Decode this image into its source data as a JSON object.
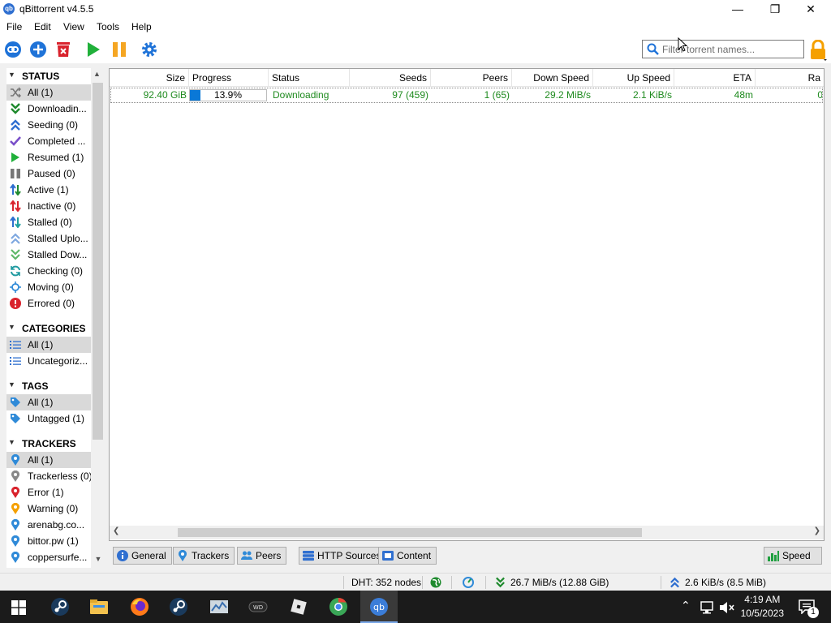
{
  "window": {
    "title": "qBittorrent v4.5.5",
    "app_icon_text": "qb"
  },
  "menu": [
    "File",
    "Edit",
    "View",
    "Tools",
    "Help"
  ],
  "search": {
    "placeholder": "Filter torrent names..."
  },
  "sidebar": {
    "status_header": "STATUS",
    "status": [
      "All (1)",
      "Downloadin...",
      "Seeding (0)",
      "Completed ...",
      "Resumed (1)",
      "Paused (0)",
      "Active (1)",
      "Inactive (0)",
      "Stalled (0)",
      "Stalled Uplo...",
      "Stalled Dow...",
      "Checking (0)",
      "Moving (0)",
      "Errored (0)"
    ],
    "categories_header": "CATEGORIES",
    "categories": [
      "All (1)",
      "Uncategoriz..."
    ],
    "tags_header": "TAGS",
    "tags": [
      "All (1)",
      "Untagged (1)"
    ],
    "trackers_header": "TRACKERS",
    "trackers": [
      "All (1)",
      "Trackerless (0)",
      "Error (1)",
      "Warning (0)",
      "arenabg.co...",
      "bittor.pw (1)",
      "coppersurfe..."
    ]
  },
  "columns": [
    "Size",
    "Progress",
    "Status",
    "Seeds",
    "Peers",
    "Down Speed",
    "Up Speed",
    "ETA",
    "Ra"
  ],
  "torrent": {
    "size": "92.40 GiB",
    "progress_text": "13.9%",
    "progress_fraction": 0.139,
    "status": "Downloading",
    "seeds": "97 (459)",
    "peers": "1 (65)",
    "down_speed": "29.2 MiB/s",
    "up_speed": "2.1 KiB/s",
    "eta": "48m",
    "ratio": "0"
  },
  "tabs": [
    "General",
    "Trackers",
    "Peers",
    "HTTP Sources",
    "Content"
  ],
  "speed_button": "Speed",
  "statusbar": {
    "dht": "DHT: 352 nodes",
    "down": "26.7 MiB/s (12.88 GiB)",
    "up": "2.6 KiB/s (8.5 MiB)"
  },
  "clock": {
    "time": "4:19 AM",
    "date": "10/5/2023"
  },
  "notification_count": "1",
  "colors": {
    "accent": "#0a78d7",
    "downloading_text": "#1e8a1e",
    "taskbar": "#1b1b1b"
  }
}
